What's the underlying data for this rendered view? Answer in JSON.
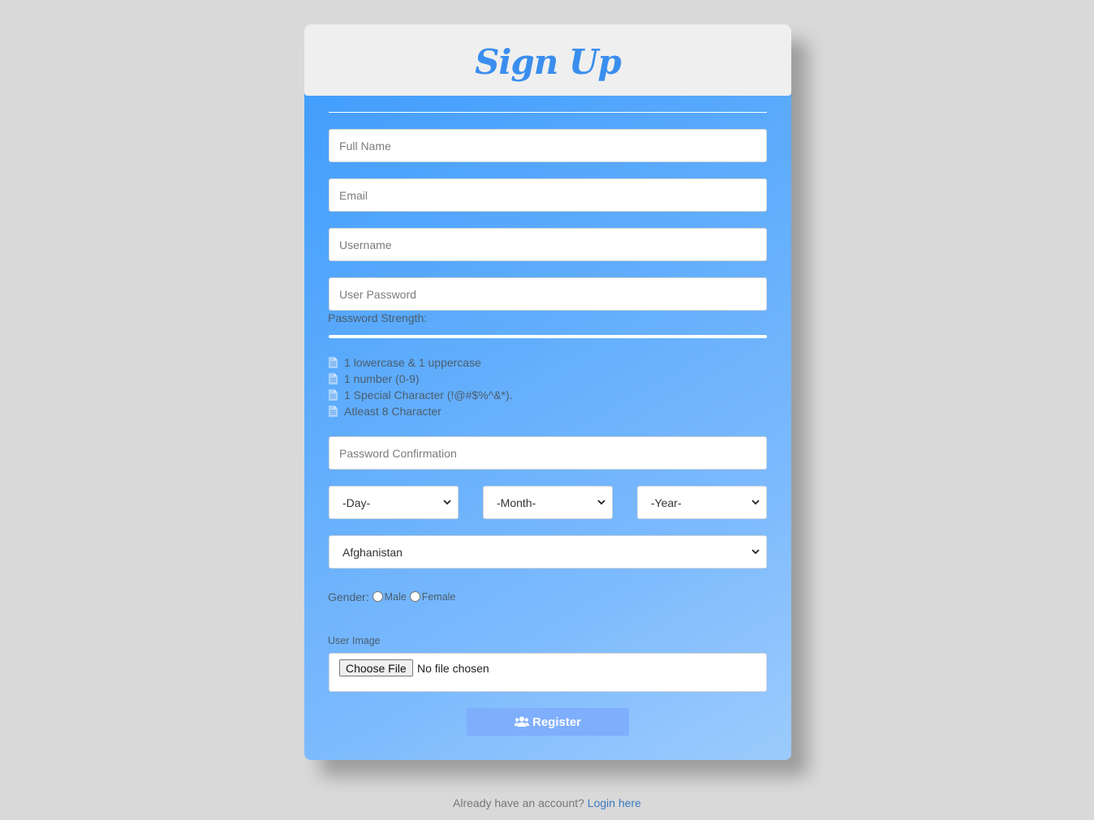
{
  "header": {
    "title": "Sign Up"
  },
  "form": {
    "full_name_placeholder": "Full Name",
    "email_placeholder": "Email",
    "username_placeholder": "Username",
    "password_placeholder": "User Password",
    "password_strength_label": "Password Strength:",
    "requirements": [
      "1 lowercase & 1 uppercase",
      "1 number (0-9)",
      "1 Special Character (!@#$%^&*).",
      "Atleast 8 Character"
    ],
    "confirm_placeholder": "Password Confirmation",
    "day_value": "-Day-",
    "month_value": "-Month-",
    "year_value": "-Year-",
    "country_value": "Afghanistan",
    "gender_label": "Gender:",
    "gender_male": "Male",
    "gender_female": "Female",
    "user_image_label": "User Image",
    "choose_file_label": "Choose File",
    "file_status": "No file chosen",
    "register_label": "Register"
  },
  "footer": {
    "text": "Already have an account?",
    "link": "Login here"
  },
  "colors": {
    "title": "#3a8eee",
    "card_gradient_start": "#3d9bfc",
    "card_gradient_end": "#9ccbfd",
    "register_button": "#7eaefc",
    "link": "#3c79c0"
  },
  "icons": {
    "requirement": "document-icon",
    "register": "users-icon",
    "select": "chevron-down-icon"
  }
}
